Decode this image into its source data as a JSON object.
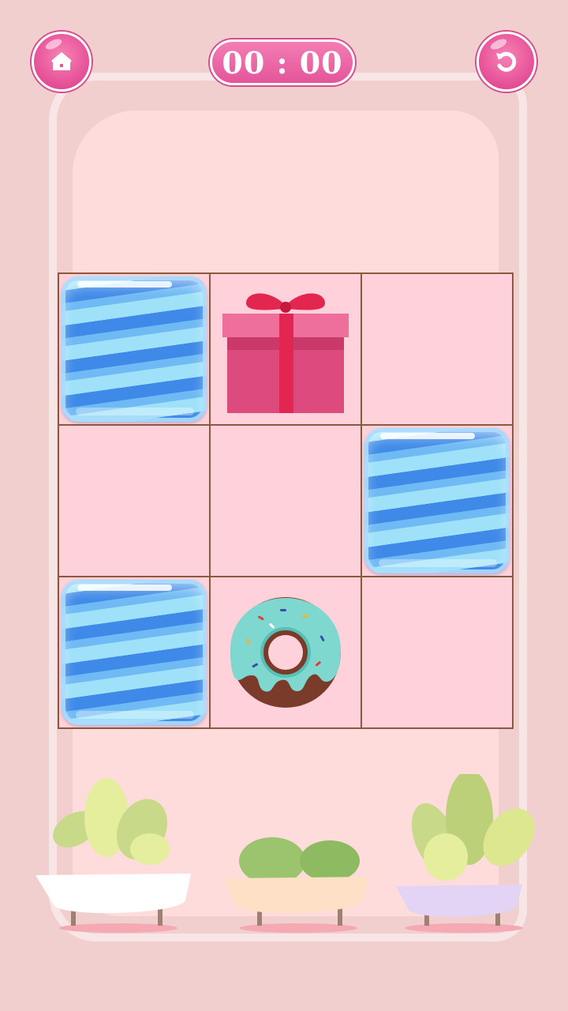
{
  "timer": {
    "text": "00 : 00"
  },
  "top_buttons": {
    "home_icon": "home-icon",
    "restart_icon": "restart-icon"
  },
  "board": {
    "rows": 3,
    "cols": 3,
    "cells": [
      [
        "water",
        "gift",
        "empty"
      ],
      [
        "empty",
        "empty",
        "water"
      ],
      [
        "water",
        "donut",
        "empty"
      ]
    ]
  },
  "colors": {
    "accent": "#e8559a",
    "grid_line": "#8b5a3c",
    "cell_bg": "#ffd1da",
    "background": "#f2cfcf"
  },
  "plants": [
    "plant-pot-white",
    "plant-pot-peach",
    "plant-pot-lavender"
  ]
}
